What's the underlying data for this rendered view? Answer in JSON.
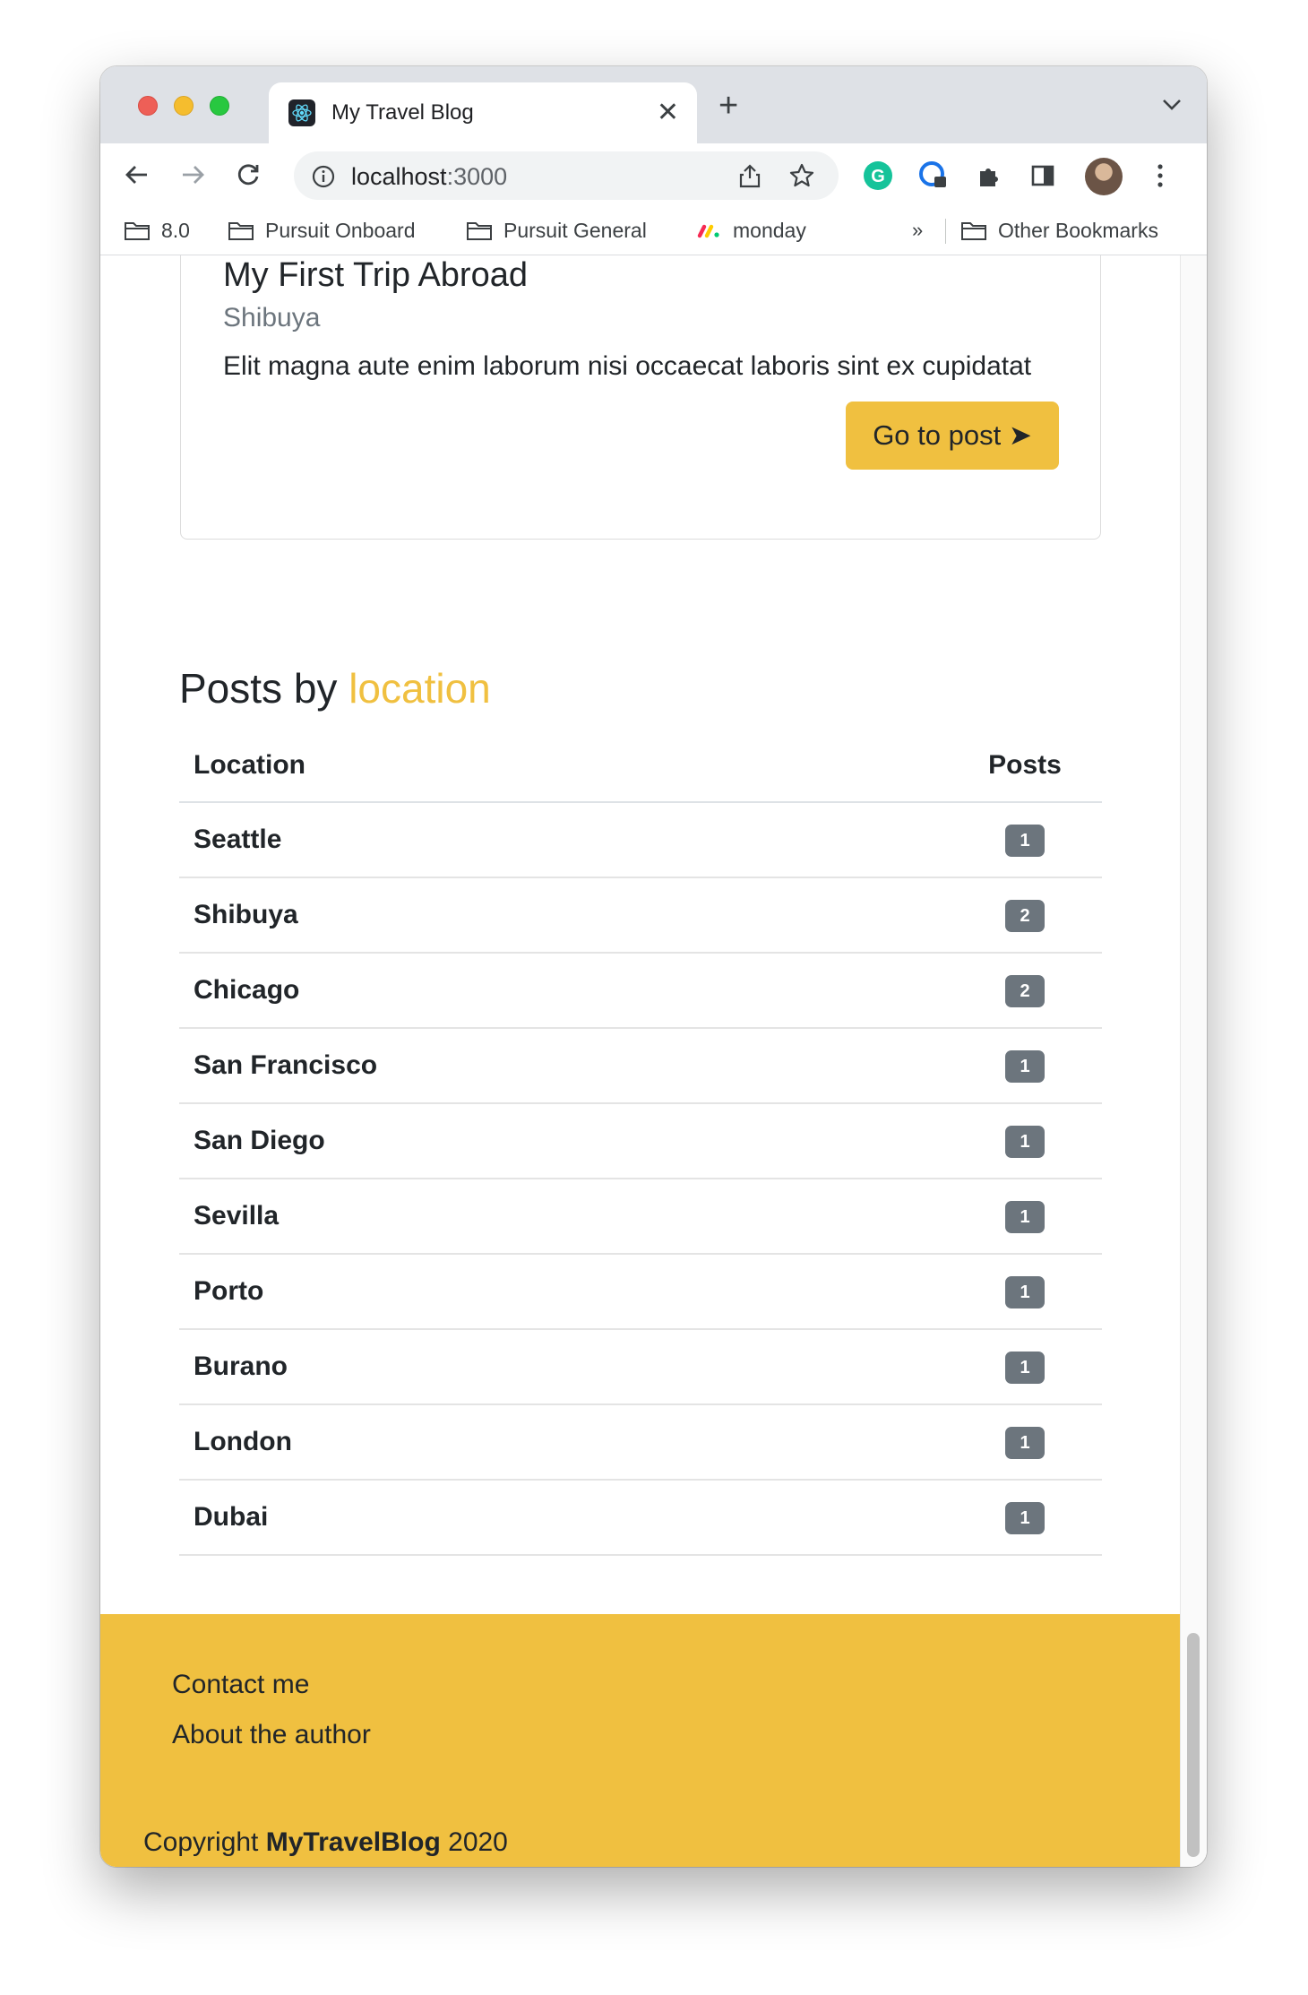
{
  "browser": {
    "tab_title": "My Travel Blog",
    "url_host": "localhost",
    "url_port": ":3000",
    "bookmarks": [
      {
        "label": "8.0",
        "icon": "folder-icon"
      },
      {
        "label": "Pursuit Onboard",
        "icon": "folder-icon"
      },
      {
        "label": "Pursuit General",
        "icon": "folder-icon"
      },
      {
        "label": "monday",
        "icon": "monday-logo-icon"
      }
    ],
    "bookmarks_more": "»",
    "other_bookmarks": "Other Bookmarks"
  },
  "card": {
    "title": "My First Trip Abroad",
    "subtitle": "Shibuya",
    "text": "Elit magna aute enim laborum nisi occaecat laboris sint ex cupidatat",
    "button_label": "Go to post ➤"
  },
  "posts_by_location": {
    "heading_prefix": "Posts by ",
    "heading_accent": "location",
    "columns": {
      "location": "Location",
      "posts": "Posts"
    },
    "rows": [
      {
        "location": "Seattle",
        "posts": "1"
      },
      {
        "location": "Shibuya",
        "posts": "2"
      },
      {
        "location": "Chicago",
        "posts": "2"
      },
      {
        "location": "San Francisco",
        "posts": "1"
      },
      {
        "location": "San Diego",
        "posts": "1"
      },
      {
        "location": "Sevilla",
        "posts": "1"
      },
      {
        "location": "Porto",
        "posts": "1"
      },
      {
        "location": "Burano",
        "posts": "1"
      },
      {
        "location": "London",
        "posts": "1"
      },
      {
        "location": "Dubai",
        "posts": "1"
      }
    ]
  },
  "footer": {
    "contact": "Contact me",
    "about": "About the author",
    "copyright_prefix": "Copyright ",
    "copyright_brand": "MyTravelBlog",
    "copyright_year": " 2020"
  },
  "colors": {
    "accent": "#f0c040",
    "badge": "#6c757d"
  }
}
